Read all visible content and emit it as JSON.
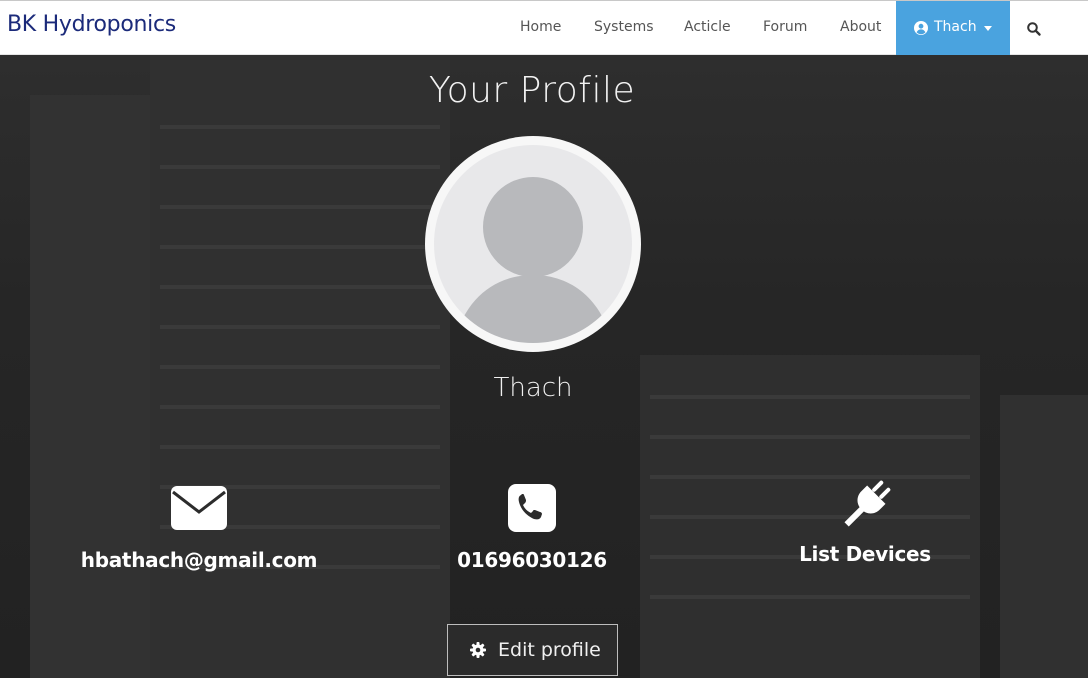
{
  "navbar": {
    "brand": "BK Hydroponics",
    "items": [
      {
        "label": "Home"
      },
      {
        "label": "Systems"
      },
      {
        "label": "Acticle"
      },
      {
        "label": "Forum"
      },
      {
        "label": "About"
      }
    ],
    "user": {
      "label": "Thach",
      "icon": "user-circle-icon",
      "color": "#4aa3df"
    },
    "search_icon": "search-icon"
  },
  "profile": {
    "title": "Your Profile",
    "username": "Thach",
    "email": "hbathach@gmail.com",
    "phone": "01696030126",
    "devices_label": "List Devices",
    "edit_label": "Edit profile"
  },
  "colors": {
    "brand": "#1b2a7a",
    "accent": "#4aa3df"
  }
}
